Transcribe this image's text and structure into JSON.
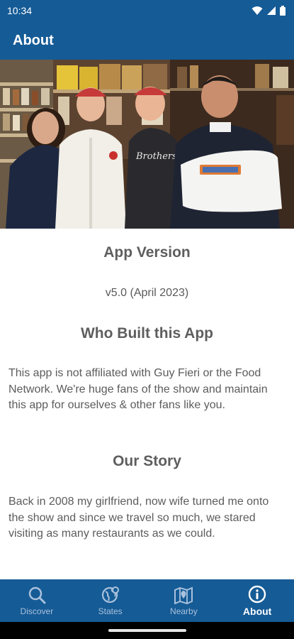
{
  "status_bar": {
    "time": "10:34",
    "icons": [
      "wifi-icon",
      "signal-icon",
      "battery-icon"
    ]
  },
  "app_bar": {
    "title": "About"
  },
  "hero": {
    "description": "Four smiling people posing in a deli/grocery store, one holding a folded white t-shirt",
    "shirt_text": "Brothers",
    "hat_badge": ""
  },
  "sections": {
    "version_title": "App Version",
    "version_value": "v5.0 (April 2023)",
    "who_title": "Who Built this App",
    "who_text": "This app is not affiliated with Guy Fieri or the Food Network. We're huge fans of the show and maintain this app for ourselves & other fans like you.",
    "story_title": "Our Story",
    "story_text": "Back in 2008 my girlfriend, now wife turned me onto the show and since we travel so much, we stared visiting as many restaurants as we could."
  },
  "bottom_nav": {
    "items": [
      {
        "label": "Discover",
        "icon": "search-icon",
        "active": false
      },
      {
        "label": "States",
        "icon": "globe-icon",
        "active": false
      },
      {
        "label": "Nearby",
        "icon": "map-pin-icon",
        "active": false
      },
      {
        "label": "About",
        "icon": "info-icon",
        "active": true
      }
    ]
  },
  "colors": {
    "primary": "#155b96",
    "inactive_nav": "#a9c1dc",
    "text": "#5a5a5a"
  }
}
